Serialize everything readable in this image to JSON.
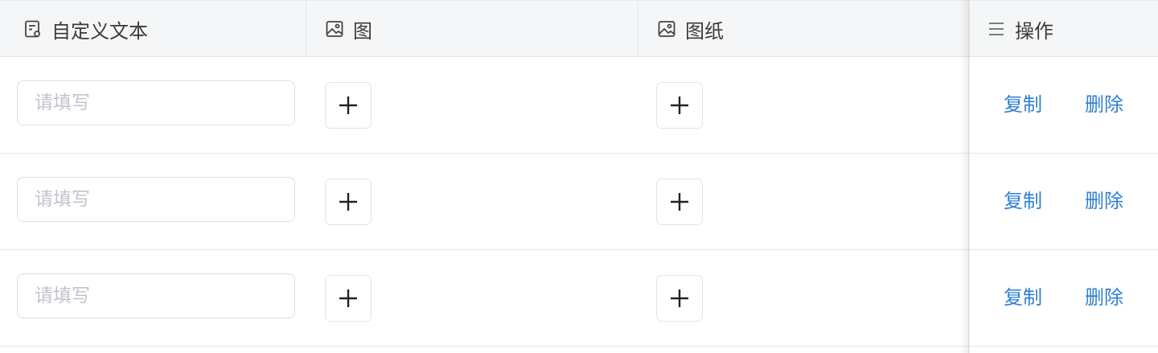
{
  "columns": {
    "custom_text": {
      "label": "自定义文本",
      "icon": "form-text-icon"
    },
    "image": {
      "label": "图",
      "icon": "image-icon"
    },
    "drawing": {
      "label": "图纸",
      "icon": "image-icon"
    },
    "actions": {
      "label": "操作",
      "icon": "list-icon"
    }
  },
  "rows": [
    {
      "text_placeholder": "请填写",
      "text_value": "",
      "copy_label": "复制",
      "delete_label": "删除"
    },
    {
      "text_placeholder": "请填写",
      "text_value": "",
      "copy_label": "复制",
      "delete_label": "删除"
    },
    {
      "text_placeholder": "请填写",
      "text_value": "",
      "copy_label": "复制",
      "delete_label": "删除"
    }
  ],
  "colors": {
    "header_bg": "#f5f6f7",
    "link": "#2f7fd1",
    "placeholder": "#c0c4cc",
    "border": "#dcdfe6"
  }
}
